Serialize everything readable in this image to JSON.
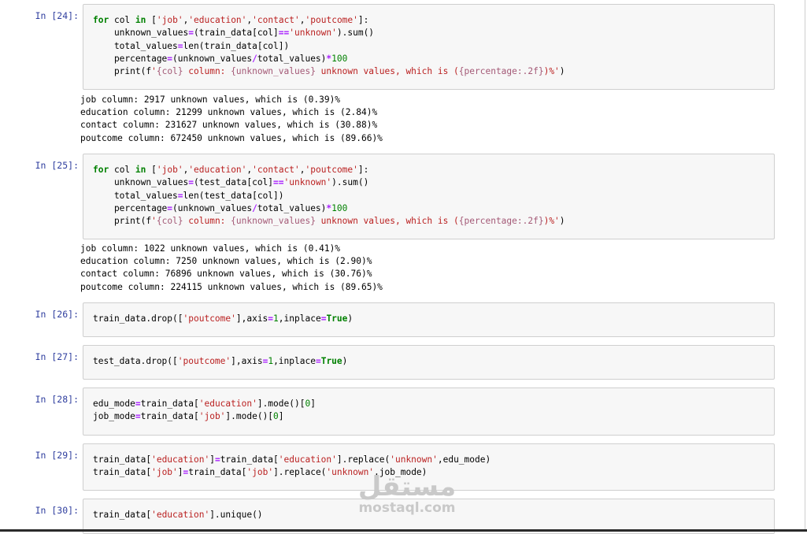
{
  "cells": [
    {
      "prompt": "In [24]:",
      "code": [
        [
          [
            "kw",
            "for"
          ],
          [
            "t",
            " col "
          ],
          [
            "kw",
            "in"
          ],
          [
            "t",
            " ["
          ],
          [
            "str",
            "'job'"
          ],
          [
            "t",
            ","
          ],
          [
            "str",
            "'education'"
          ],
          [
            "t",
            ","
          ],
          [
            "str",
            "'contact'"
          ],
          [
            "t",
            ","
          ],
          [
            "str",
            "'poutcome'"
          ],
          [
            "t",
            "]:"
          ]
        ],
        [
          [
            "t",
            "    unknown_values"
          ],
          [
            "op",
            "="
          ],
          [
            "t",
            "(train_data[col]"
          ],
          [
            "op",
            "=="
          ],
          [
            "str",
            "'unknown'"
          ],
          [
            "t",
            ").sum()"
          ]
        ],
        [
          [
            "t",
            "    total_values"
          ],
          [
            "op",
            "="
          ],
          [
            "t",
            "len(train_data[col])"
          ]
        ],
        [
          [
            "t",
            "    percentage"
          ],
          [
            "op",
            "="
          ],
          [
            "t",
            "(unknown_values"
          ],
          [
            "op",
            "/"
          ],
          [
            "t",
            "total_values)"
          ],
          [
            "op",
            "*"
          ],
          [
            "num",
            "100"
          ]
        ],
        [
          [
            "t",
            "    print(f"
          ],
          [
            "str",
            "'"
          ],
          [
            "fmt",
            "{col}"
          ],
          [
            "str",
            " column: "
          ],
          [
            "fmt",
            "{unknown_values}"
          ],
          [
            "str",
            " unknown values, which is ("
          ],
          [
            "fmt",
            "{percentage:.2f}"
          ],
          [
            "str",
            ")%'"
          ],
          [
            "t",
            ")"
          ]
        ]
      ],
      "output": [
        "job column: 2917 unknown values, which is (0.39)%",
        "education column: 21299 unknown values, which is (2.84)%",
        "contact column: 231627 unknown values, which is (30.88)%",
        "poutcome column: 672450 unknown values, which is (89.66)%"
      ]
    },
    {
      "prompt": "In [25]:",
      "code": [
        [
          [
            "kw",
            "for"
          ],
          [
            "t",
            " col "
          ],
          [
            "kw",
            "in"
          ],
          [
            "t",
            " ["
          ],
          [
            "str",
            "'job'"
          ],
          [
            "t",
            ","
          ],
          [
            "str",
            "'education'"
          ],
          [
            "t",
            ","
          ],
          [
            "str",
            "'contact'"
          ],
          [
            "t",
            ","
          ],
          [
            "str",
            "'poutcome'"
          ],
          [
            "t",
            "]:"
          ]
        ],
        [
          [
            "t",
            "    unknown_values"
          ],
          [
            "op",
            "="
          ],
          [
            "t",
            "(test_data[col]"
          ],
          [
            "op",
            "=="
          ],
          [
            "str",
            "'unknown'"
          ],
          [
            "t",
            ").sum()"
          ]
        ],
        [
          [
            "t",
            "    total_values"
          ],
          [
            "op",
            "="
          ],
          [
            "t",
            "len(test_data[col])"
          ]
        ],
        [
          [
            "t",
            "    percentage"
          ],
          [
            "op",
            "="
          ],
          [
            "t",
            "(unknown_values"
          ],
          [
            "op",
            "/"
          ],
          [
            "t",
            "total_values)"
          ],
          [
            "op",
            "*"
          ],
          [
            "num",
            "100"
          ]
        ],
        [
          [
            "t",
            "    print(f"
          ],
          [
            "str",
            "'"
          ],
          [
            "fmt",
            "{col}"
          ],
          [
            "str",
            " column: "
          ],
          [
            "fmt",
            "{unknown_values}"
          ],
          [
            "str",
            " unknown values, which is ("
          ],
          [
            "fmt",
            "{percentage:.2f}"
          ],
          [
            "str",
            ")%'"
          ],
          [
            "t",
            ")"
          ]
        ]
      ],
      "output": [
        "job column: 1022 unknown values, which is (0.41)%",
        "education column: 7250 unknown values, which is (2.90)%",
        "contact column: 76896 unknown values, which is (30.76)%",
        "poutcome column: 224115 unknown values, which is (89.65)%"
      ]
    },
    {
      "prompt": "In [26]:",
      "code": [
        [
          [
            "t",
            "train_data.drop(["
          ],
          [
            "str",
            "'poutcome'"
          ],
          [
            "t",
            "],axis"
          ],
          [
            "op",
            "="
          ],
          [
            "num",
            "1"
          ],
          [
            "t",
            ",inplace"
          ],
          [
            "op",
            "="
          ],
          [
            "kw",
            "True"
          ],
          [
            "t",
            ")"
          ]
        ]
      ],
      "output": []
    },
    {
      "prompt": "In [27]:",
      "code": [
        [
          [
            "t",
            "test_data.drop(["
          ],
          [
            "str",
            "'poutcome'"
          ],
          [
            "t",
            "],axis"
          ],
          [
            "op",
            "="
          ],
          [
            "num",
            "1"
          ],
          [
            "t",
            ",inplace"
          ],
          [
            "op",
            "="
          ],
          [
            "kw",
            "True"
          ],
          [
            "t",
            ")"
          ]
        ]
      ],
      "output": []
    },
    {
      "prompt": "In [28]:",
      "code": [
        [
          [
            "t",
            "edu_mode"
          ],
          [
            "op",
            "="
          ],
          [
            "t",
            "train_data["
          ],
          [
            "str",
            "'education'"
          ],
          [
            "t",
            "].mode()["
          ],
          [
            "num",
            "0"
          ],
          [
            "t",
            "]"
          ]
        ],
        [
          [
            "t",
            "job_mode"
          ],
          [
            "op",
            "="
          ],
          [
            "t",
            "train_data["
          ],
          [
            "str",
            "'job'"
          ],
          [
            "t",
            "].mode()["
          ],
          [
            "num",
            "0"
          ],
          [
            "t",
            "]"
          ]
        ]
      ],
      "output": []
    },
    {
      "prompt": "In [29]:",
      "code": [
        [
          [
            "t",
            "train_data["
          ],
          [
            "str",
            "'education'"
          ],
          [
            "t",
            "]"
          ],
          [
            "op",
            "="
          ],
          [
            "t",
            "train_data["
          ],
          [
            "str",
            "'education'"
          ],
          [
            "t",
            "].replace("
          ],
          [
            "str",
            "'unknown'"
          ],
          [
            "t",
            ",edu_mode)"
          ]
        ],
        [
          [
            "t",
            "train_data["
          ],
          [
            "str",
            "'job'"
          ],
          [
            "t",
            "]"
          ],
          [
            "op",
            "="
          ],
          [
            "t",
            "train_data["
          ],
          [
            "str",
            "'job'"
          ],
          [
            "t",
            "].replace("
          ],
          [
            "str",
            "'unknown'"
          ],
          [
            "t",
            ",job_mode)"
          ]
        ]
      ],
      "output": []
    },
    {
      "prompt": "In [30]:",
      "code": [
        [
          [
            "t",
            "train_data["
          ],
          [
            "str",
            "'education'"
          ],
          [
            "t",
            "].unique()"
          ]
        ]
      ],
      "output": []
    }
  ],
  "watermark": {
    "logo": "مستقل",
    "text": "mostaql.com"
  }
}
